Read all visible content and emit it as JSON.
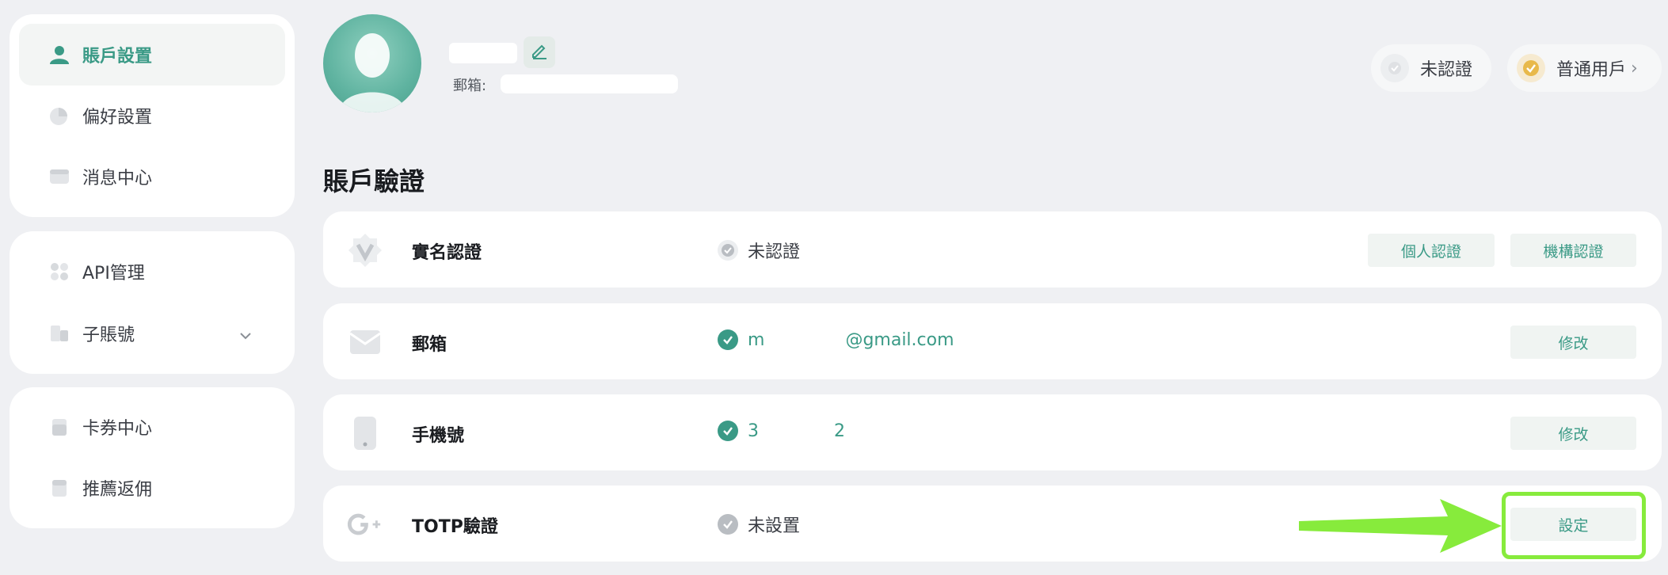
{
  "sidebar": {
    "groups": [
      {
        "items": [
          {
            "label": "賬戶設置",
            "icon": "user-icon",
            "active": true
          },
          {
            "label": "偏好設置",
            "icon": "preferences-icon"
          },
          {
            "label": "消息中心",
            "icon": "message-icon"
          }
        ]
      },
      {
        "items": [
          {
            "label": "API管理",
            "icon": "api-icon"
          },
          {
            "label": "子賬號",
            "icon": "sub-account-icon",
            "expandable": true
          }
        ]
      },
      {
        "items": [
          {
            "label": "卡券中心",
            "icon": "coupon-icon"
          },
          {
            "label": "推薦返佣",
            "icon": "referral-icon"
          }
        ]
      }
    ]
  },
  "header": {
    "email_label": "郵箱:",
    "verify_status": "未認證",
    "user_level": "普通用戶",
    "user_level_chevron": "›"
  },
  "section": {
    "title": "賬戶驗證",
    "rows": [
      {
        "label": "實名認證",
        "icon": "verified-badge-icon",
        "status": "未認證",
        "status_type": "neutral",
        "buttons": [
          "個人認證",
          "機構認證"
        ]
      },
      {
        "label": "郵箱",
        "icon": "envelope-icon",
        "status_prefix": "m",
        "status": "@gmail.com",
        "status_type": "success",
        "buttons": [
          "修改"
        ]
      },
      {
        "label": "手機號",
        "icon": "phone-icon",
        "status_prefix": "3",
        "status": "2",
        "status_type": "success",
        "buttons": [
          "修改"
        ]
      },
      {
        "label": "TOTP驗證",
        "icon": "google-plus-icon",
        "status": "未設置",
        "status_type": "neutral",
        "buttons": [
          "設定"
        ]
      }
    ]
  },
  "colors": {
    "accent": "#3a9a86",
    "page_bg": "#eff0f3",
    "annotation": "#87eb3c",
    "gold": "#e8b94a"
  }
}
